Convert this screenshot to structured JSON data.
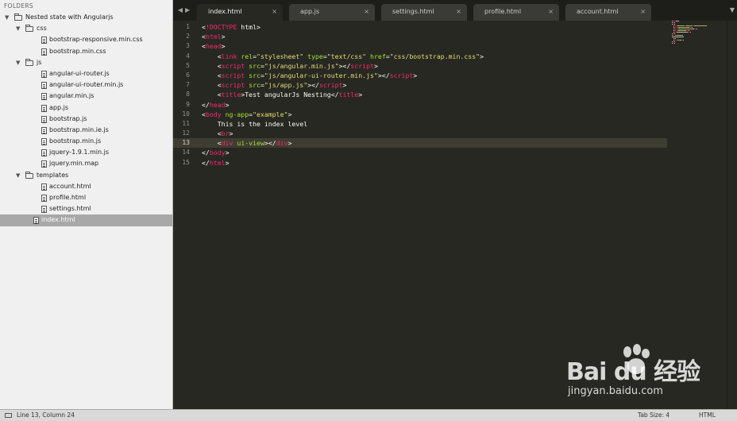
{
  "sidebar": {
    "header": "FOLDERS",
    "tree": [
      {
        "label": "Nested state with Angularjs",
        "kind": "folder",
        "depth": 0,
        "open": true,
        "selected": false
      },
      {
        "label": "css",
        "kind": "folder",
        "depth": 1,
        "open": true,
        "selected": false
      },
      {
        "label": "bootstrap-responsive.min.css",
        "kind": "file",
        "depth": 2,
        "selected": false
      },
      {
        "label": "bootstrap.min.css",
        "kind": "file",
        "depth": 2,
        "selected": false
      },
      {
        "label": "js",
        "kind": "folder",
        "depth": 1,
        "open": true,
        "selected": false
      },
      {
        "label": "angular-ui-router.js",
        "kind": "file",
        "depth": 2,
        "selected": false
      },
      {
        "label": "angular-ui-router.min.js",
        "kind": "file",
        "depth": 2,
        "selected": false
      },
      {
        "label": "angular.min.js",
        "kind": "file",
        "depth": 2,
        "selected": false
      },
      {
        "label": "app.js",
        "kind": "file",
        "depth": 2,
        "selected": false
      },
      {
        "label": "bootstrap.js",
        "kind": "file",
        "depth": 2,
        "selected": false
      },
      {
        "label": "bootstrap.min.ie.js",
        "kind": "file",
        "depth": 2,
        "selected": false
      },
      {
        "label": "bootstrap.min.js",
        "kind": "file",
        "depth": 2,
        "selected": false
      },
      {
        "label": "jquery-1.9.1.min.js",
        "kind": "file",
        "depth": 2,
        "selected": false
      },
      {
        "label": "jquery.min.map",
        "kind": "file",
        "depth": 2,
        "selected": false
      },
      {
        "label": "templates",
        "kind": "folder",
        "depth": 1,
        "open": true,
        "selected": false
      },
      {
        "label": "account.html",
        "kind": "file",
        "depth": 2,
        "selected": false
      },
      {
        "label": "profile.html",
        "kind": "file",
        "depth": 2,
        "selected": false
      },
      {
        "label": "settings.html",
        "kind": "file",
        "depth": 2,
        "selected": false
      },
      {
        "label": "index.html",
        "kind": "file",
        "depth": 1,
        "selected": true
      }
    ]
  },
  "tabs": [
    {
      "label": "index.html",
      "active": true,
      "close": "×"
    },
    {
      "label": "app.js",
      "active": false,
      "close": "×"
    },
    {
      "label": "settings.html",
      "active": false,
      "close": "×"
    },
    {
      "label": "profile.html",
      "active": false,
      "close": "×"
    },
    {
      "label": "account.html",
      "active": false,
      "close": "×"
    }
  ],
  "nav": {
    "prev": "◀",
    "next": "▶",
    "menu": "▼"
  },
  "editor": {
    "current_line": 13,
    "colors": {
      "tag": "#f92672",
      "attr": "#a6e22e",
      "string": "#e6db74",
      "text": "#f8f8f2",
      "background": "#272822"
    },
    "lines": [
      [
        [
          "p",
          "<"
        ],
        [
          "t",
          "!DOCTYPE"
        ],
        [
          "x",
          " html"
        ],
        [
          "p",
          ">"
        ]
      ],
      [
        [
          "p",
          "<"
        ],
        [
          "t",
          "html"
        ],
        [
          "p",
          ">"
        ]
      ],
      [
        [
          "p",
          "<"
        ],
        [
          "t",
          "head"
        ],
        [
          "p",
          ">"
        ]
      ],
      [
        [
          "x",
          "    "
        ],
        [
          "p",
          "<"
        ],
        [
          "t",
          "link"
        ],
        [
          "x",
          " "
        ],
        [
          "a",
          "rel"
        ],
        [
          "p",
          "="
        ],
        [
          "s",
          "\"stylesheet\""
        ],
        [
          "x",
          " "
        ],
        [
          "a",
          "type"
        ],
        [
          "p",
          "="
        ],
        [
          "s",
          "\"text/css\""
        ],
        [
          "x",
          " "
        ],
        [
          "a",
          "href"
        ],
        [
          "p",
          "="
        ],
        [
          "s",
          "\"css/bootstrap.min.css\""
        ],
        [
          "p",
          ">"
        ]
      ],
      [
        [
          "x",
          "    "
        ],
        [
          "p",
          "<"
        ],
        [
          "t",
          "script"
        ],
        [
          "x",
          " "
        ],
        [
          "a",
          "src"
        ],
        [
          "p",
          "="
        ],
        [
          "s",
          "\"js/angular.min.js\""
        ],
        [
          "p",
          ">"
        ],
        [
          "p",
          "</"
        ],
        [
          "t",
          "script"
        ],
        [
          "p",
          ">"
        ]
      ],
      [
        [
          "x",
          "    "
        ],
        [
          "p",
          "<"
        ],
        [
          "t",
          "script"
        ],
        [
          "x",
          " "
        ],
        [
          "a",
          "src"
        ],
        [
          "p",
          "="
        ],
        [
          "s",
          "\"js/angular-ui-router.min.js\""
        ],
        [
          "p",
          ">"
        ],
        [
          "p",
          "</"
        ],
        [
          "t",
          "script"
        ],
        [
          "p",
          ">"
        ]
      ],
      [
        [
          "x",
          "    "
        ],
        [
          "p",
          "<"
        ],
        [
          "t",
          "script"
        ],
        [
          "x",
          " "
        ],
        [
          "a",
          "src"
        ],
        [
          "p",
          "="
        ],
        [
          "s",
          "\"js/app.js\""
        ],
        [
          "p",
          ">"
        ],
        [
          "p",
          "</"
        ],
        [
          "t",
          "script"
        ],
        [
          "p",
          ">"
        ]
      ],
      [
        [
          "x",
          "    "
        ],
        [
          "p",
          "<"
        ],
        [
          "t",
          "title"
        ],
        [
          "p",
          ">"
        ],
        [
          "x",
          "Test angularJs Nesting"
        ],
        [
          "p",
          "</"
        ],
        [
          "t",
          "title"
        ],
        [
          "p",
          ">"
        ]
      ],
      [
        [
          "p",
          "</"
        ],
        [
          "t",
          "head"
        ],
        [
          "p",
          ">"
        ]
      ],
      [
        [
          "p",
          "<"
        ],
        [
          "t",
          "body"
        ],
        [
          "x",
          " "
        ],
        [
          "a",
          "ng-app"
        ],
        [
          "p",
          "="
        ],
        [
          "s",
          "\"example\""
        ],
        [
          "p",
          ">"
        ]
      ],
      [
        [
          "x",
          "    This is the index level"
        ]
      ],
      [
        [
          "x",
          "    "
        ],
        [
          "p",
          "<"
        ],
        [
          "t",
          "br"
        ],
        [
          "p",
          ">"
        ]
      ],
      [
        [
          "x",
          "    "
        ],
        [
          "p",
          "<"
        ],
        [
          "t",
          "div"
        ],
        [
          "x",
          " "
        ],
        [
          "a",
          "ui-view"
        ],
        [
          "p",
          ">"
        ],
        [
          "p",
          "</"
        ],
        [
          "t",
          "div"
        ],
        [
          "p",
          ">"
        ]
      ],
      [
        [
          "p",
          "</"
        ],
        [
          "t",
          "body"
        ],
        [
          "p",
          ">"
        ]
      ],
      [
        [
          "p",
          "</"
        ],
        [
          "t",
          "html"
        ],
        [
          "p",
          ">"
        ]
      ]
    ]
  },
  "watermark": {
    "logo": "Bai du 经验",
    "site": "jingyan.baidu.com"
  },
  "status": {
    "position": "Line 13, Column 24",
    "tab_size": "Tab Size: 4",
    "syntax": "HTML"
  }
}
